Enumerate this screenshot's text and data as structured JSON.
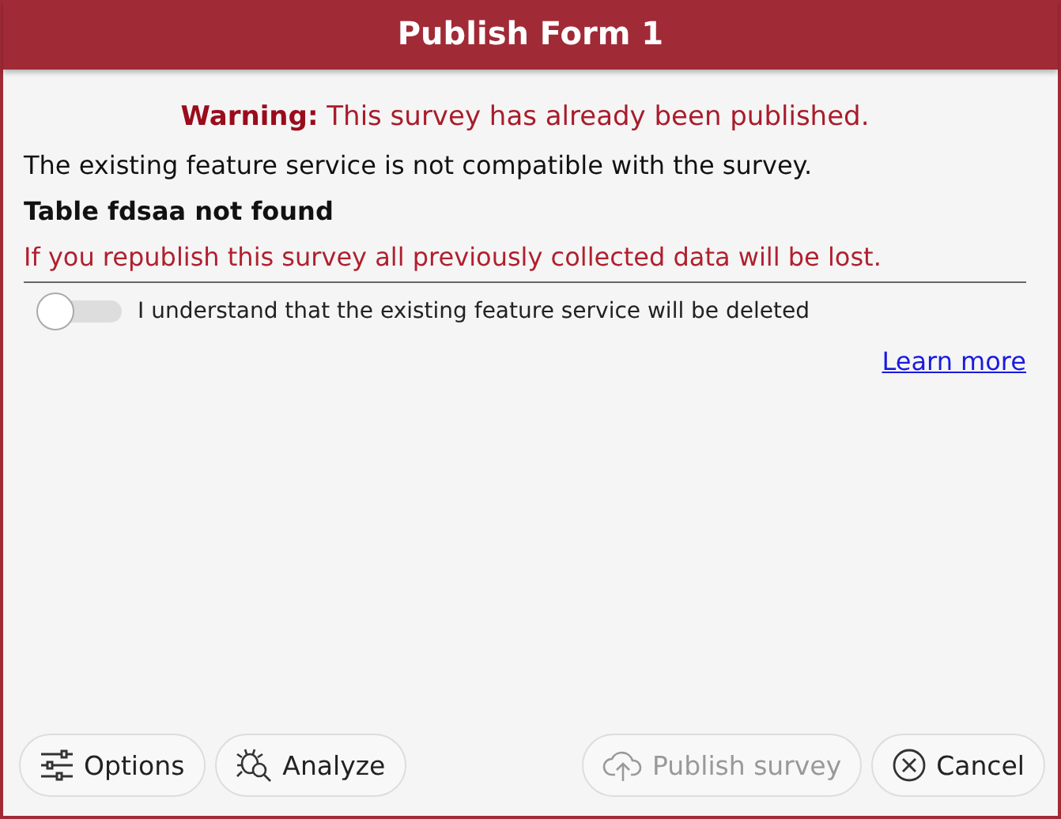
{
  "window": {
    "title": "Publish Form 1"
  },
  "warning": "**Warning:** This survey has already been published.",
  "message": "The existing feature service is not compatible with the survey.",
  "error": "Table fdsaa not found",
  "caution": "If you republish this survey all previously collected data will be lost.",
  "confirm": {
    "label": "I understand that the existing feature service will be deleted",
    "on": false
  },
  "link": "Learn more",
  "buttons": [
    {
      "kind": "options",
      "label": "Options",
      "disabled": false
    },
    {
      "kind": "analyze",
      "label": "Analyze",
      "disabled": false
    },
    {
      "kind": "publish",
      "label": "Publish survey",
      "disabled": true
    },
    {
      "kind": "cancel",
      "label": "Cancel",
      "disabled": false
    }
  ]
}
